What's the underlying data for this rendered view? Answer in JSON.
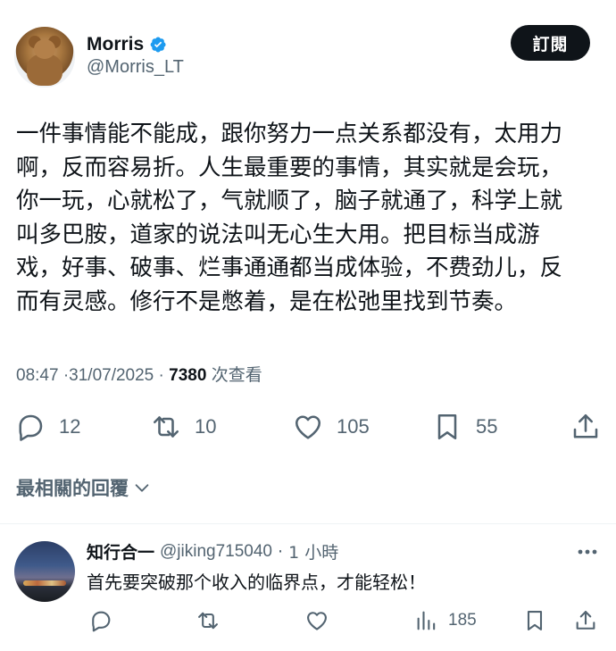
{
  "author": {
    "display_name": "Morris",
    "handle": "@Morris_LT",
    "verified": true,
    "avatar_icon": "bear-avatar"
  },
  "subscribe_label": "訂閱",
  "tweet": {
    "lines": [
      "一件事情能不能成，跟你努力一点关系都没有，太用力",
      "啊，反而容易折。人生最重要的事情，其实就是会玩，",
      "你一玩，心就松了，气就顺了，脑子就通了，科学上就",
      "叫多巴胺，道家的说法叫无心生大用。把目标当成游",
      "戏，好事、破事、烂事通通都当成体验，不费劲儿，反",
      "而有灵感。修行不是憋着，是在松弛里找到节奏。"
    ],
    "time": "08:47",
    "date": "31/07/2025",
    "separator": "·",
    "views_count": "7380",
    "views_label": "次查看"
  },
  "stats": {
    "replies": "12",
    "retweets": "10",
    "likes": "105",
    "bookmarks": "55"
  },
  "sort_label": "最相關的回覆",
  "reply": {
    "name": "知行合一",
    "handle": "@jiking715040",
    "separator": "·",
    "time": "1 小時",
    "text": "首先要突破那个收入的临界点，才能轻松！",
    "views": "185"
  },
  "colors": {
    "text": "#0f1419",
    "muted": "#536471",
    "verified": "#1d9bf0",
    "button_bg": "#0f1419"
  }
}
